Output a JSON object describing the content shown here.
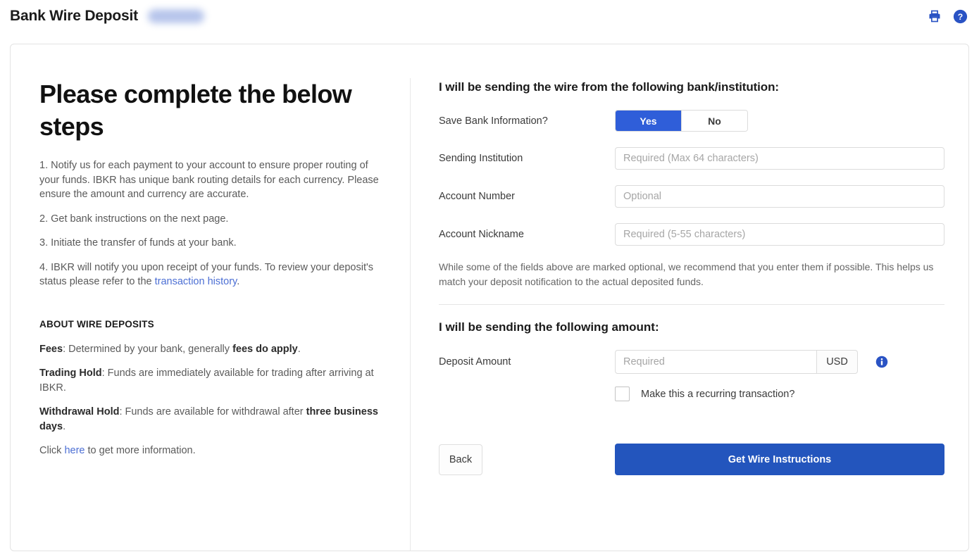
{
  "header": {
    "title": "Bank Wire Deposit",
    "redacted_badge": "",
    "print_icon": "print-icon",
    "help_icon": "help-circle-icon"
  },
  "left": {
    "headline": "Please complete the below steps",
    "steps": [
      "1. Notify us for each payment to your account to ensure proper routing of your funds. IBKR has unique bank routing details for each currency. Please ensure the amount and currency are accurate.",
      "2. Get bank instructions on the next page.",
      "3. Initiate the transfer of funds at your bank."
    ],
    "step4_prefix": "4. IBKR will notify you upon receipt of your funds. To review your deposit's status please refer to the ",
    "step4_link": "transaction history",
    "step4_suffix": ".",
    "about_title": "ABOUT WIRE DEPOSITS",
    "fees_label": "Fees",
    "fees_text_1": ": Determined by your bank, generally ",
    "fees_bold": "fees do apply",
    "fees_text_2": ".",
    "trading_label": "Trading Hold",
    "trading_text": ": Funds are immediately available for trading after arriving at IBKR.",
    "withdrawal_label": "Withdrawal Hold",
    "withdrawal_text_1": ": Funds are available for withdrawal after ",
    "withdrawal_bold": "three business days",
    "withdrawal_text_2": ".",
    "more_prefix": "Click ",
    "more_link": "here",
    "more_suffix": " to get more information."
  },
  "right": {
    "section1_title": "I will be sending the wire from the following bank/institution:",
    "save_bank_label": "Save Bank Information?",
    "toggle_yes": "Yes",
    "toggle_no": "No",
    "toggle_selected": "Yes",
    "sending_institution_label": "Sending Institution",
    "sending_institution_placeholder": "Required (Max 64 characters)",
    "sending_institution_value": "",
    "account_number_label": "Account Number",
    "account_number_placeholder": "Optional",
    "account_number_value": "",
    "account_nickname_label": "Account Nickname",
    "account_nickname_placeholder": "Required (5-55 characters)",
    "account_nickname_value": "",
    "note": "While some of the fields above are marked optional, we recommend that you enter them if possible. This helps us match your deposit notification to the actual deposited funds.",
    "section2_title": "I will be sending the following amount:",
    "deposit_amount_label": "Deposit Amount",
    "deposit_amount_placeholder": "Required",
    "deposit_amount_value": "",
    "currency": "USD",
    "info_icon": "info-circle-icon",
    "recurring_label": "Make this a recurring transaction?",
    "recurring_checked": false,
    "back_label": "Back",
    "submit_label": "Get Wire Instructions"
  },
  "colors": {
    "primary_button": "#2355bd",
    "toggle_active": "#2f5ed9",
    "link": "#4c6fd4",
    "icon_blue": "#2a53c4",
    "border": "#dcdcdc"
  }
}
